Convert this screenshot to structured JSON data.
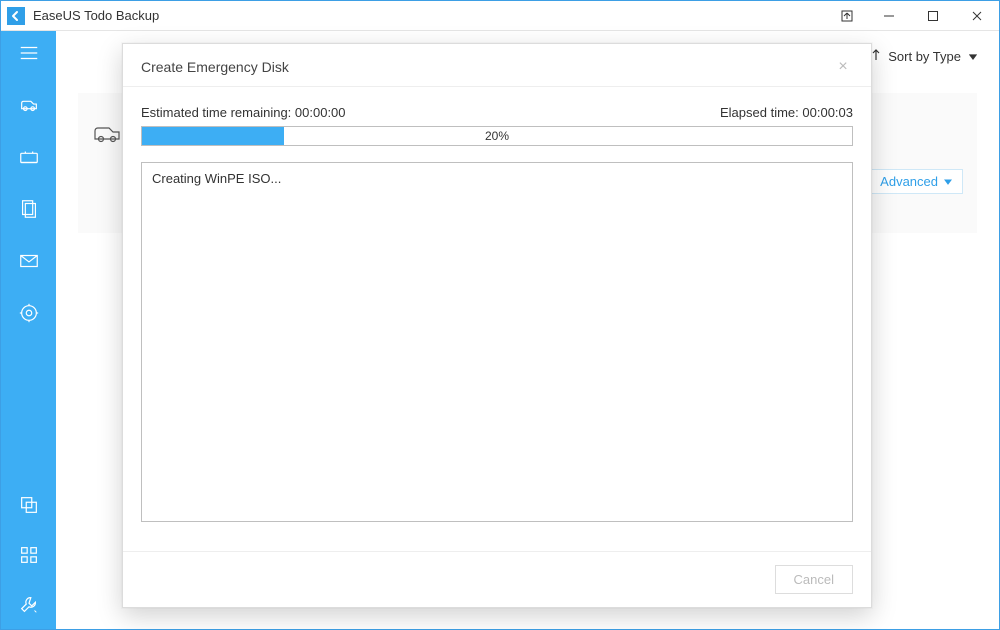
{
  "app": {
    "title": "EaseUS Todo Backup"
  },
  "toprow": {
    "sort_label": "Sort by Type"
  },
  "card": {
    "advanced_label": "Advanced"
  },
  "modal": {
    "title": "Create Emergency Disk",
    "eta_label": "Estimated time remaining:",
    "eta_value": "00:00:00",
    "elapsed_label": "Elapsed time:",
    "elapsed_value": "00:00:03",
    "progress_percent": "20%",
    "progress_width": "20%",
    "log_text": "Creating WinPE ISO...",
    "cancel_label": "Cancel"
  }
}
